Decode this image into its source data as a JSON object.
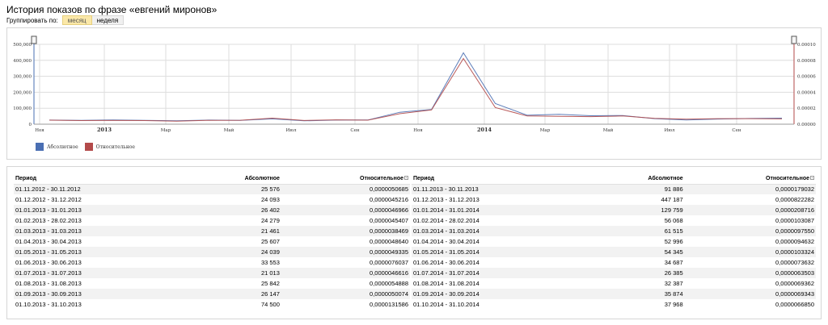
{
  "page": {
    "title": "История показов по фразе «евгений миронов»"
  },
  "grouping": {
    "label": "Группировать по:",
    "options": [
      "месяц",
      "неделя"
    ],
    "selected": "месяц"
  },
  "legend": {
    "absolute": "Абсолютное",
    "relative": "Относительное"
  },
  "colors": {
    "absolute": "#4a6fb3",
    "relative": "#b34a4a",
    "grid": "#dddddd",
    "handle": "#555555"
  },
  "chart_data": {
    "type": "line",
    "x_labels": [
      "Ноя",
      "2013",
      "Мар",
      "Май",
      "Июл",
      "Сен",
      "Ноя",
      "2014",
      "Мар",
      "Май",
      "Июл",
      "Сен"
    ],
    "bold_labels": [
      "2013",
      "2014"
    ],
    "left_ticks": [
      "500,000",
      "400,000",
      "300,000",
      "200,000",
      "100,000",
      "0"
    ],
    "right_ticks": [
      "0.00010",
      "0.00008",
      "0.00006",
      "0.00004",
      "0.00002",
      "0.00000"
    ],
    "ylim_left": [
      0,
      500000
    ],
    "ylim_right": [
      0,
      0.0001
    ],
    "grid": true,
    "legend_position": "bottom-left",
    "series": [
      {
        "name": "Абсолютное",
        "axis": "left",
        "values": [
          25576,
          24093,
          26402,
          24279,
          21461,
          25607,
          24039,
          33553,
          21013,
          25842,
          26147,
          74500,
          91886,
          447187,
          129759,
          56068,
          61515,
          52996,
          54345,
          34687,
          26385,
          32387,
          35874,
          37968
        ]
      },
      {
        "name": "Относительное",
        "axis": "right",
        "values": [
          5.0685e-06,
          4.5216e-06,
          4.6966e-06,
          4.5407e-06,
          3.8469e-06,
          4.864e-06,
          4.9335e-06,
          7.6037e-06,
          4.6616e-06,
          5.4888e-06,
          5.0074e-06,
          1.31586e-05,
          1.79032e-05,
          8.22282e-05,
          2.08716e-05,
          1.03087e-05,
          9.75e-06,
          9.4632e-06,
          1.03324e-05,
          7.3632e-06,
          6.3503e-06,
          6.9362e-06,
          6.9343e-06,
          6.685e-06
        ]
      }
    ]
  },
  "table": {
    "headers": {
      "period": "Период",
      "absolute": "Абсолютное",
      "relative": "Относительное"
    },
    "left_rows": [
      {
        "period": "01.11.2012 - 30.11.2012",
        "absolute": "25 576",
        "relative": "0,0000050685"
      },
      {
        "period": "01.12.2012 - 31.12.2012",
        "absolute": "24 093",
        "relative": "0,0000045216"
      },
      {
        "period": "01.01.2013 - 31.01.2013",
        "absolute": "26 402",
        "relative": "0,0000046966"
      },
      {
        "period": "01.02.2013 - 28.02.2013",
        "absolute": "24 279",
        "relative": "0,0000045407"
      },
      {
        "period": "01.03.2013 - 31.03.2013",
        "absolute": "21 461",
        "relative": "0,0000038469"
      },
      {
        "period": "01.04.2013 - 30.04.2013",
        "absolute": "25 607",
        "relative": "0,0000048640"
      },
      {
        "period": "01.05.2013 - 31.05.2013",
        "absolute": "24 039",
        "relative": "0,0000049335"
      },
      {
        "period": "01.06.2013 - 30.06.2013",
        "absolute": "33 553",
        "relative": "0,0000076037"
      },
      {
        "period": "01.07.2013 - 31.07.2013",
        "absolute": "21 013",
        "relative": "0,0000046616"
      },
      {
        "period": "01.08.2013 - 31.08.2013",
        "absolute": "25 842",
        "relative": "0,0000054888"
      },
      {
        "period": "01.09.2013 - 30.09.2013",
        "absolute": "26 147",
        "relative": "0,0000050074"
      },
      {
        "period": "01.10.2013 - 31.10.2013",
        "absolute": "74 500",
        "relative": "0,0000131586"
      }
    ],
    "right_rows": [
      {
        "period": "01.11.2013 - 30.11.2013",
        "absolute": "91 886",
        "relative": "0,0000179032"
      },
      {
        "period": "01.12.2013 - 31.12.2013",
        "absolute": "447 187",
        "relative": "0,0000822282"
      },
      {
        "period": "01.01.2014 - 31.01.2014",
        "absolute": "129 759",
        "relative": "0,0000208716"
      },
      {
        "period": "01.02.2014 - 28.02.2014",
        "absolute": "56 068",
        "relative": "0,0000103087"
      },
      {
        "period": "01.03.2014 - 31.03.2014",
        "absolute": "61 515",
        "relative": "0,0000097550"
      },
      {
        "period": "01.04.2014 - 30.04.2014",
        "absolute": "52 996",
        "relative": "0,0000094632"
      },
      {
        "period": "01.05.2014 - 31.05.2014",
        "absolute": "54 345",
        "relative": "0,0000103324"
      },
      {
        "period": "01.06.2014 - 30.06.2014",
        "absolute": "34 687",
        "relative": "0,0000073632"
      },
      {
        "period": "01.07.2014 - 31.07.2014",
        "absolute": "26 385",
        "relative": "0,0000063503"
      },
      {
        "period": "01.08.2014 - 31.08.2014",
        "absolute": "32 387",
        "relative": "0,0000069362"
      },
      {
        "period": "01.09.2014 - 30.09.2014",
        "absolute": "35 874",
        "relative": "0,0000069343"
      },
      {
        "period": "01.10.2014 - 31.10.2014",
        "absolute": "37 968",
        "relative": "0,0000066850"
      }
    ]
  }
}
